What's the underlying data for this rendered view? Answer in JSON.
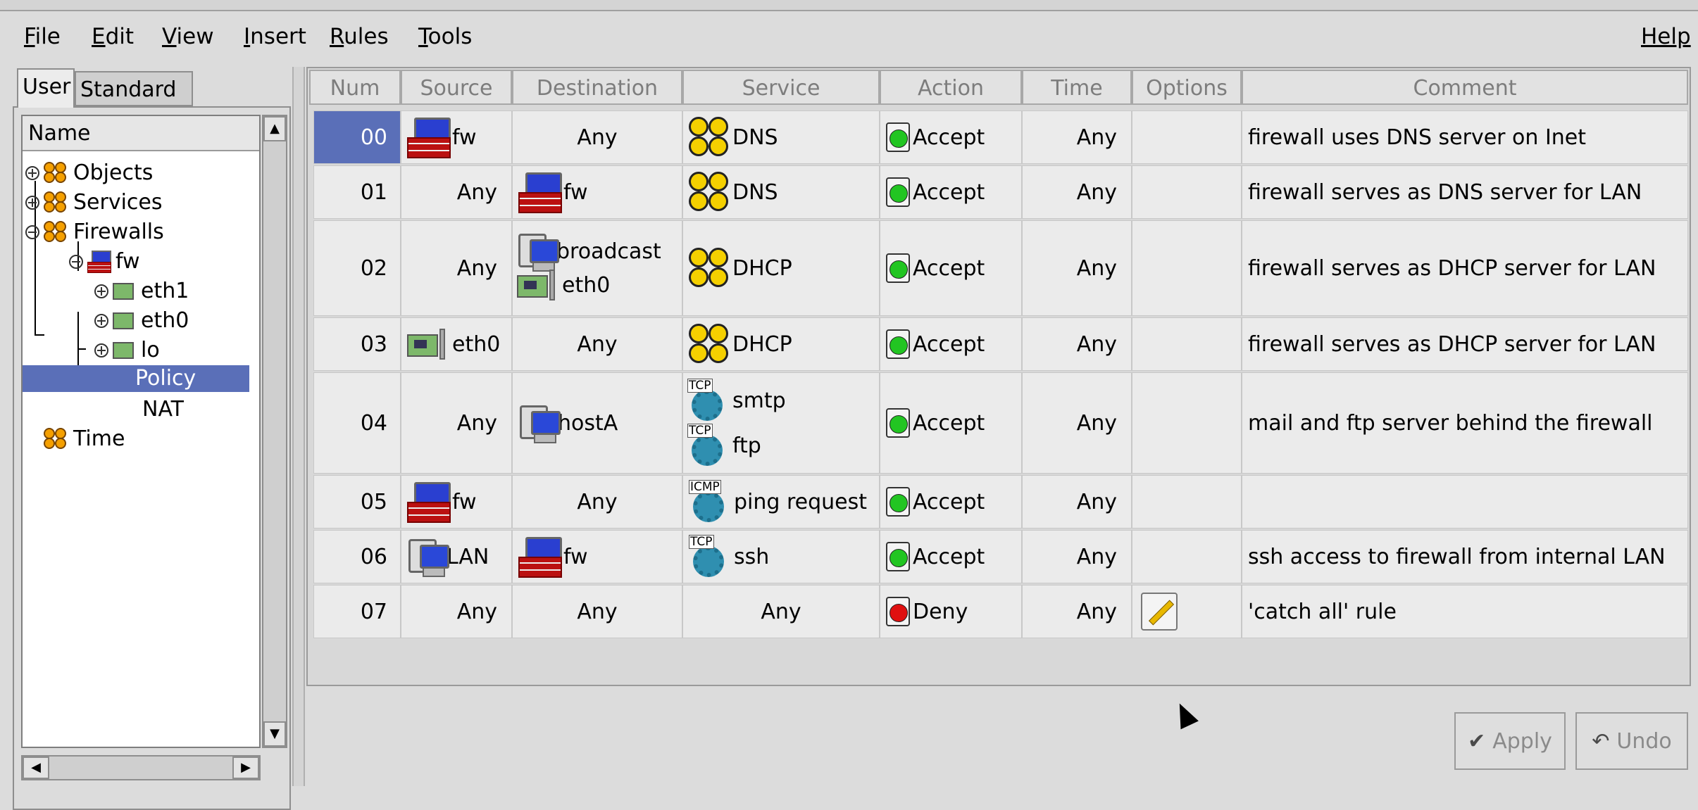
{
  "menubar": {
    "items": [
      {
        "label": "File",
        "underline": "F"
      },
      {
        "label": "Edit",
        "underline": "E"
      },
      {
        "label": "View",
        "underline": "V"
      },
      {
        "label": "Insert",
        "underline": "I"
      },
      {
        "label": "Rules",
        "underline": "R"
      },
      {
        "label": "Tools",
        "underline": "T"
      }
    ],
    "help": "Help"
  },
  "left_panel": {
    "tabs": [
      "User",
      "Standard"
    ],
    "tree_header": "Name",
    "tree": {
      "objects": "Objects",
      "services": "Services",
      "firewalls": "Firewalls",
      "fw": "fw",
      "eth1": "eth1",
      "eth0": "eth0",
      "lo": "lo",
      "policy": "Policy",
      "nat": "NAT",
      "time": "Time"
    },
    "selected": "Policy"
  },
  "table": {
    "columns": [
      "Num",
      "Source",
      "Destination",
      "Service",
      "Action",
      "Time",
      "Options",
      "Comment"
    ],
    "rows": [
      {
        "num": "00",
        "source": "fw",
        "destination": "Any",
        "service": "DNS",
        "action": "Accept",
        "time": "Any",
        "comment": "firewall uses DNS server on Inet"
      },
      {
        "num": "01",
        "source": "Any",
        "destination": "fw",
        "service": "DNS",
        "action": "Accept",
        "time": "Any",
        "comment": "firewall serves as DNS server for LAN"
      },
      {
        "num": "02",
        "source": "Any",
        "destination": [
          "broadcast",
          "eth0"
        ],
        "service": "DHCP",
        "action": "Accept",
        "time": "Any",
        "comment": "firewall serves as DHCP server for LAN"
      },
      {
        "num": "03",
        "source": "eth0",
        "destination": "Any",
        "service": "DHCP",
        "action": "Accept",
        "time": "Any",
        "comment": "firewall serves as DHCP server for LAN"
      },
      {
        "num": "04",
        "source": "Any",
        "destination": "hostA",
        "service": [
          "smtp",
          "ftp"
        ],
        "action": "Accept",
        "time": "Any",
        "comment": "mail and ftp server behind the firewall"
      },
      {
        "num": "05",
        "source": "fw",
        "destination": "Any",
        "service": "ping request",
        "action": "Accept",
        "time": "Any",
        "comment": ""
      },
      {
        "num": "06",
        "source": "LAN",
        "destination": "fw",
        "service": "ssh",
        "action": "Accept",
        "time": "Any",
        "comment": "ssh access to firewall from internal LAN"
      },
      {
        "num": "07",
        "source": "Any",
        "destination": "Any",
        "service": "Any",
        "action": "Deny",
        "time": "Any",
        "comment": "'catch all' rule"
      }
    ],
    "selected_row": "00",
    "icon_labels": {
      "tcp": "TCP",
      "icmp": "ICMP"
    }
  },
  "buttons": {
    "apply": "Apply",
    "undo": "Undo"
  },
  "colors": {
    "selection": "#5a6fb8",
    "accept": "#22c522",
    "deny": "#e01010"
  }
}
